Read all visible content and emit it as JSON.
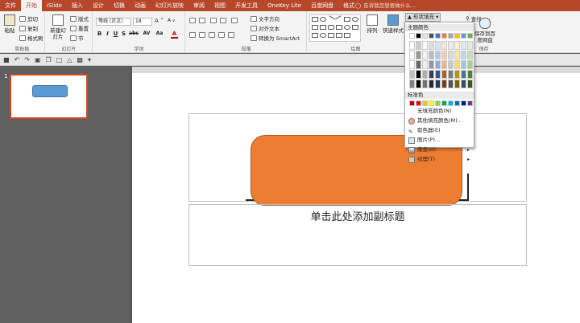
{
  "tabs": [
    {
      "label": "文件"
    },
    {
      "label": "开始"
    },
    {
      "label": "iSlide"
    },
    {
      "label": "插入"
    },
    {
      "label": "设计"
    },
    {
      "label": "切换"
    },
    {
      "label": "动画"
    },
    {
      "label": "幻灯片放映"
    },
    {
      "label": "审阅"
    },
    {
      "label": "视图"
    },
    {
      "label": "开发工具"
    },
    {
      "label": "OneKey Lite"
    },
    {
      "label": "百度网盘"
    },
    {
      "label": "格式"
    }
  ],
  "tell_me": "告诉我您想要做什么...",
  "clipboard": {
    "paste": "粘贴",
    "cut": "剪切",
    "copy": "复制",
    "format_painter": "格式刷",
    "group": "剪贴板"
  },
  "slides_group": {
    "new_slide": "新建幻灯片",
    "layout": "版式",
    "reset": "重置",
    "section": "节",
    "group": "幻灯片"
  },
  "font": {
    "name": "等线 (正文)",
    "size": "18",
    "group": "字体",
    "bold": "B",
    "italic": "I",
    "underline": "U",
    "shadow": "S",
    "strike": "abc",
    "spacing": "AV",
    "case": "Aa",
    "color": "A"
  },
  "paragraph": {
    "text_direction": "文字方向",
    "align_text": "对齐文本",
    "smartart": "转换为 SmartArt",
    "group": "段落"
  },
  "drawing": {
    "arrange": "排列",
    "quick_styles": "快速样式",
    "group": "绘图",
    "fill_button": "形状填充",
    "find": "查找"
  },
  "save": {
    "label": "保存到百度网盘",
    "group": "保存"
  },
  "fill_menu": {
    "theme_header": "主题颜色",
    "standard_header": "标准色",
    "no_fill": "无填充颜色(N)",
    "more_colors": "其他填充颜色(M)...",
    "eyedropper": "取色器(E)",
    "picture": "图片(P)...",
    "gradient": "渐变(G)",
    "texture": "纹理(T)",
    "theme_colors": [
      "#ffffff",
      "#000000",
      "#e7e6e6",
      "#44546a",
      "#4472c4",
      "#ed7d31",
      "#a5a5a5",
      "#ffc000",
      "#5b9bd5",
      "#70ad47"
    ],
    "standard_colors": [
      "#c00000",
      "#ff0000",
      "#ffc000",
      "#ffff00",
      "#92d050",
      "#00b050",
      "#00b0f0",
      "#0070c0",
      "#002060",
      "#7030a0"
    ]
  },
  "slide_pane": {
    "number": "1"
  },
  "slide": {
    "subtitle_placeholder": "单击此处添加副标题"
  },
  "colors": {
    "accent": "#b7472a",
    "shape_fill": "#ed7d31",
    "thumb_shape_fill": "#5b9bd5"
  }
}
